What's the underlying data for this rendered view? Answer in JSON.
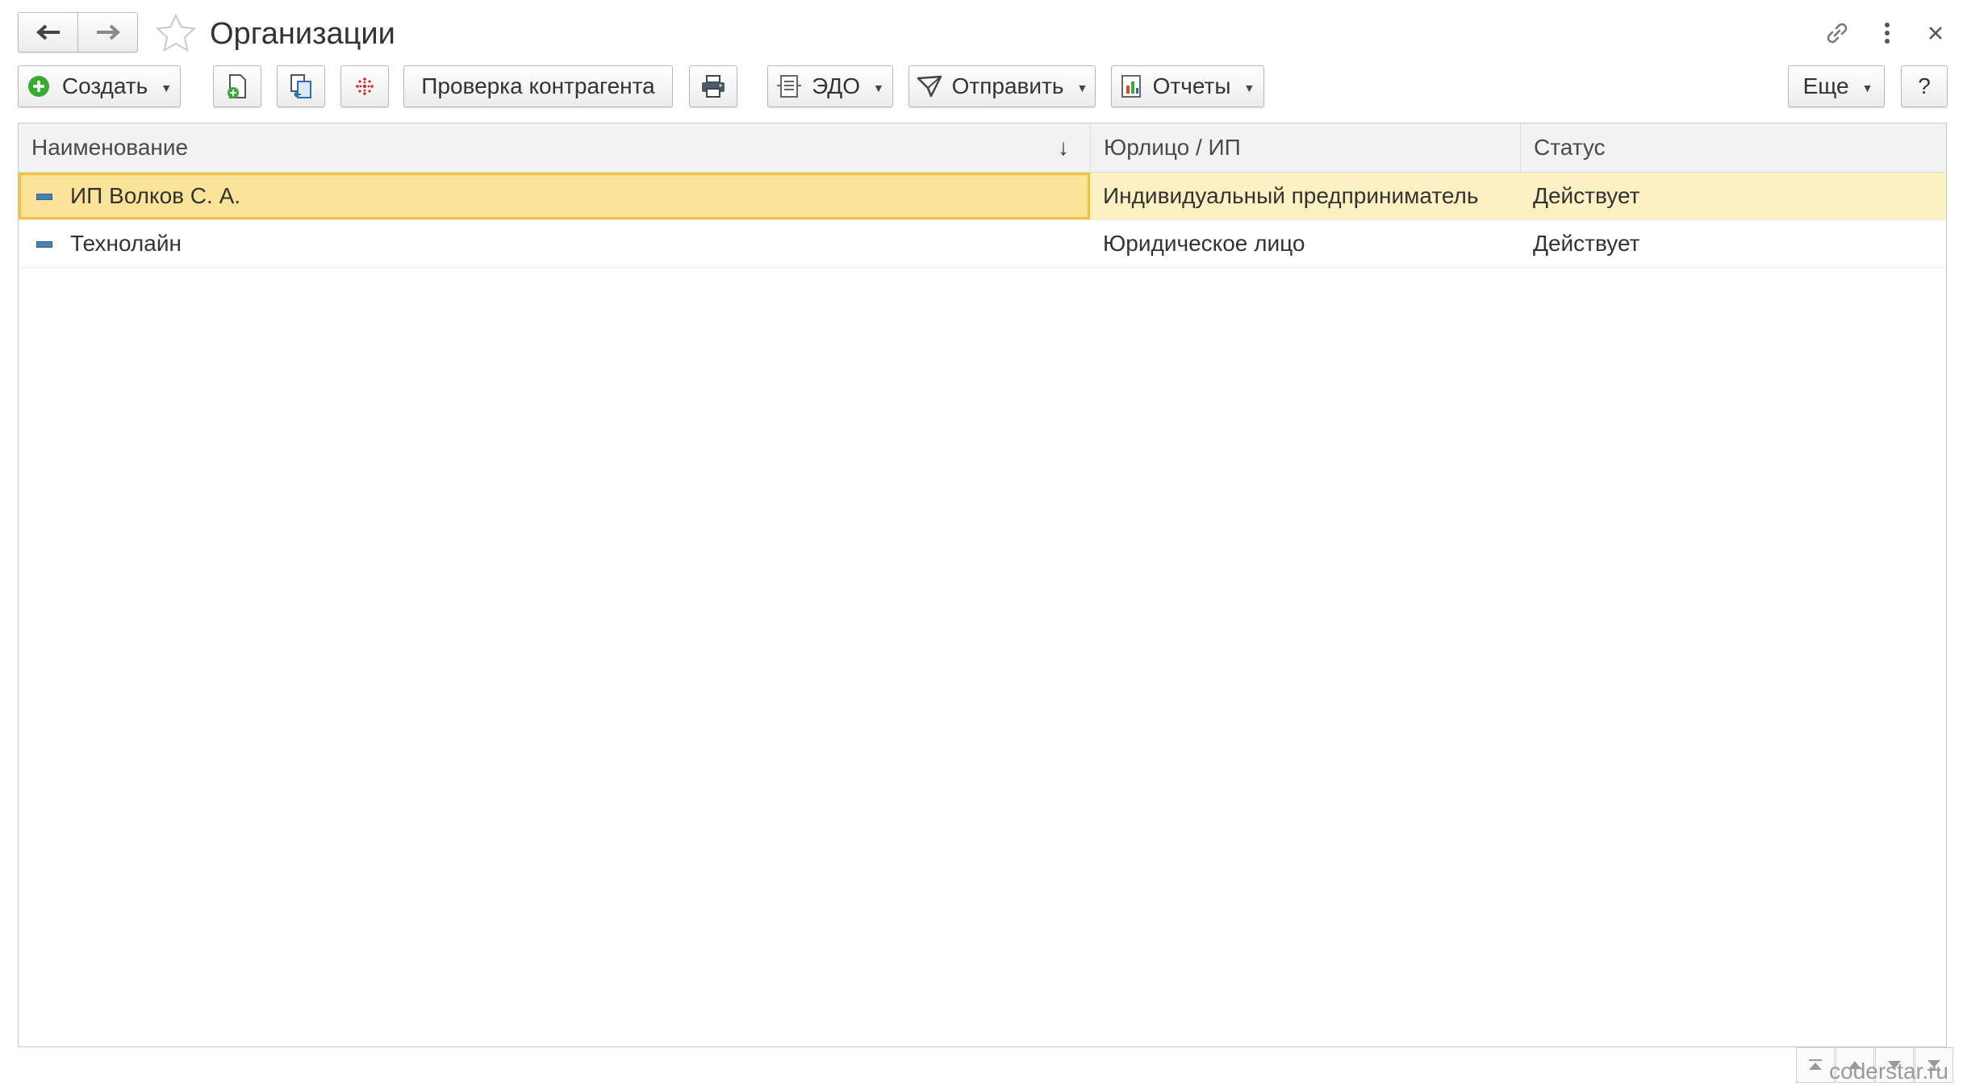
{
  "window": {
    "title": "Организации"
  },
  "toolbar": {
    "create_label": "Создать",
    "check_label": "Проверка контрагента",
    "edo_label": "ЭДО",
    "send_label": "Отправить",
    "reports_label": "Отчеты",
    "more_label": "Еще",
    "help_label": "?"
  },
  "icons": {
    "back": "arrow-left-icon",
    "forward": "arrow-right-icon",
    "favorite": "star-icon",
    "link": "link-icon",
    "menu": "more-vertical-icon",
    "close": "close-icon",
    "create": "plus-circle-icon",
    "copy": "document-add-icon",
    "replace": "document-swap-icon",
    "structure": "dots-asterisk-icon",
    "print": "printer-icon"
  },
  "table": {
    "columns": [
      "Наименование",
      "Юрлицо / ИП",
      "Статус"
    ],
    "sort_indicator": "↓",
    "rows": [
      {
        "name": "ИП Волков С. А.",
        "type": "Индивидуальный предприниматель",
        "status": "Действует"
      },
      {
        "name": "Технолайн",
        "type": "Юридическое лицо",
        "status": "Действует"
      }
    ]
  },
  "footer": {
    "watermark": "coderstar.ru"
  },
  "colors": {
    "selected_row": "#fbf1c2",
    "focus_border": "#f1c23a",
    "create_icon_green": "#3aaa35"
  }
}
